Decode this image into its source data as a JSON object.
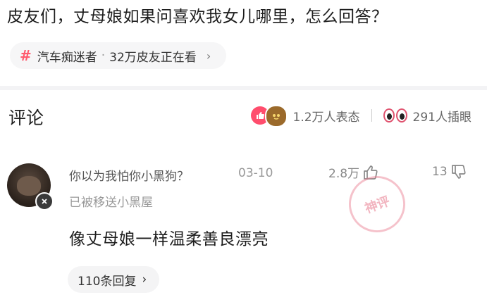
{
  "post": {
    "title": "皮友们，丈母娘如果问喜欢我女儿哪里，怎么回答？"
  },
  "topic": {
    "hash": "#",
    "name": "汽车痴迷者",
    "separator": "·",
    "viewers": "32万皮友正在看",
    "chevron": "›"
  },
  "comments_header": {
    "title": "评论",
    "reactions": "1.2万人表态",
    "inserts": "291人插眼"
  },
  "comment": {
    "username": "你以为我怕你小黑狗？",
    "date": "03-10",
    "likes": "2.8万",
    "dislikes": "13",
    "status": "已被移送小黑屋",
    "text": "像丈母娘一样温柔善良漂亮",
    "stamp": "神评",
    "replies": "110条回复",
    "replies_chevron": "›"
  },
  "colors": {
    "accent": "#ff4d6d",
    "text": "#1e1e1e",
    "muted": "#999999"
  }
}
